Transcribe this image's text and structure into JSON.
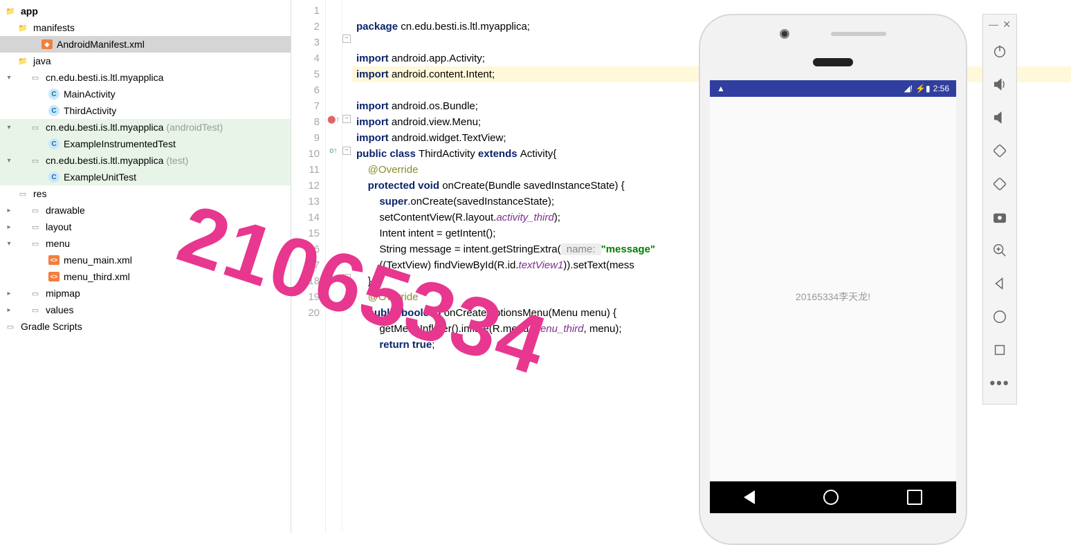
{
  "tree": {
    "app": "app",
    "manifests": "manifests",
    "manifest_file": "AndroidManifest.xml",
    "java": "java",
    "pkg1": "cn.edu.besti.is.ltl.myapplica",
    "cls_main": "MainActivity",
    "cls_third": "ThirdActivity",
    "pkg2": "cn.edu.besti.is.ltl.myapplica",
    "pkg2_suffix": "(androidTest)",
    "cls_inst": "ExampleInstrumentedTest",
    "pkg3": "cn.edu.besti.is.ltl.myapplica",
    "pkg3_suffix": "(test)",
    "cls_unit": "ExampleUnitTest",
    "res": "res",
    "drawable": "drawable",
    "layout": "layout",
    "menu": "menu",
    "menu_main": "menu_main.xml",
    "menu_third": "menu_third.xml",
    "mipmap": "mipmap",
    "values": "values",
    "gradle": "Gradle Scripts"
  },
  "lines": [
    "1",
    "2",
    "3",
    "4",
    "5",
    "6",
    "7",
    "8",
    "9",
    "10",
    "11",
    "12",
    "13",
    "14",
    "15",
    "16",
    "17",
    "18",
    "19",
    "20"
  ],
  "code": {
    "l1_kw": "package",
    "l1_rest": " cn.edu.besti.is.ltl.myapplica;",
    "l3_kw": "import",
    "l3_rest": " android.app.Activity;",
    "l4_kw": "import",
    "l4_rest": " android.content.Intent;",
    "l5_kw": "import",
    "l5_rest": " android.os.Bundle;",
    "l6_kw": "import",
    "l6_rest": " android.view.Menu;",
    "l7_kw": "import",
    "l7_rest": " android.widget.TextView;",
    "l8_kw1": "public class ",
    "l8_name": "ThirdActivity ",
    "l8_kw2": "extends ",
    "l8_rest": "Activity{",
    "l9_ann": "@Override",
    "l10_kw": "protected void ",
    "l10_rest": "onCreate(Bundle savedInstanceState) {",
    "l11_kw": "super",
    "l11_rest": ".onCreate(savedInstanceState);",
    "l12_a": "setContentView(R.layout.",
    "l12_f": "activity_third",
    "l12_b": ");",
    "l13": "Intent intent = getIntent();",
    "l14_a": "String message = intent.getStringExtra(",
    "l14_hint": " name: ",
    "l14_str": "\"message\"",
    "l15_a": "((TextView) findViewById(R.id.",
    "l15_f": "textView1",
    "l15_b": ")).setText(mess",
    "l16": "}",
    "l17_ann": "@Override",
    "l18_kw": "public boolean ",
    "l18_rest": "onCreateOptionsMenu(Menu menu) {",
    "l19_a": "getMenuInflater().inflate(R.menu.",
    "l19_f": "menu_third",
    "l19_b": ", menu);",
    "l20_kw": "return true",
    "l20_b": ";"
  },
  "phone": {
    "time": "2:56",
    "app_text": "20165334李天龙!"
  },
  "watermark": "21065334",
  "emu": {
    "min": "—",
    "close": "✕"
  }
}
